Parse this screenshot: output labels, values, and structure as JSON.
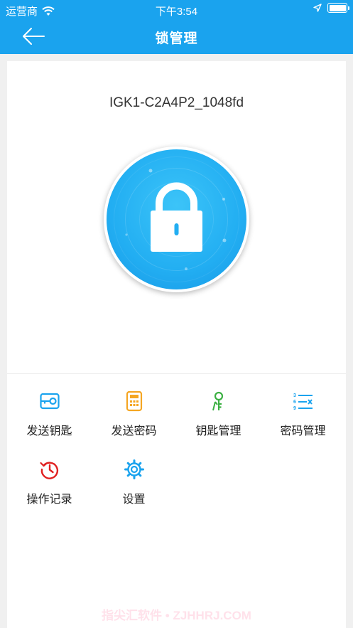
{
  "status_bar": {
    "carrier": "运营商",
    "time": "下午3:54"
  },
  "nav": {
    "title": "锁管理"
  },
  "device": {
    "name": "IGK1-C2A4P2_1048fd"
  },
  "actions": [
    {
      "label": "发送钥匙",
      "icon": "send-key-icon",
      "color": "#1aa3ee"
    },
    {
      "label": "发送密码",
      "icon": "calculator-icon",
      "color": "#f5a623"
    },
    {
      "label": "钥匙管理",
      "icon": "key-manage-icon",
      "color": "#3cb043"
    },
    {
      "label": "密码管理",
      "icon": "password-list-icon",
      "color": "#1aa3ee"
    },
    {
      "label": "操作记录",
      "icon": "history-icon",
      "color": "#e02020"
    },
    {
      "label": "设置",
      "icon": "gear-icon",
      "color": "#1aa3ee"
    }
  ],
  "watermark": "指尖汇软件 • ZJHHRJ.COM",
  "colors": {
    "primary": "#1aa3ee",
    "background": "#f0f0f0"
  }
}
